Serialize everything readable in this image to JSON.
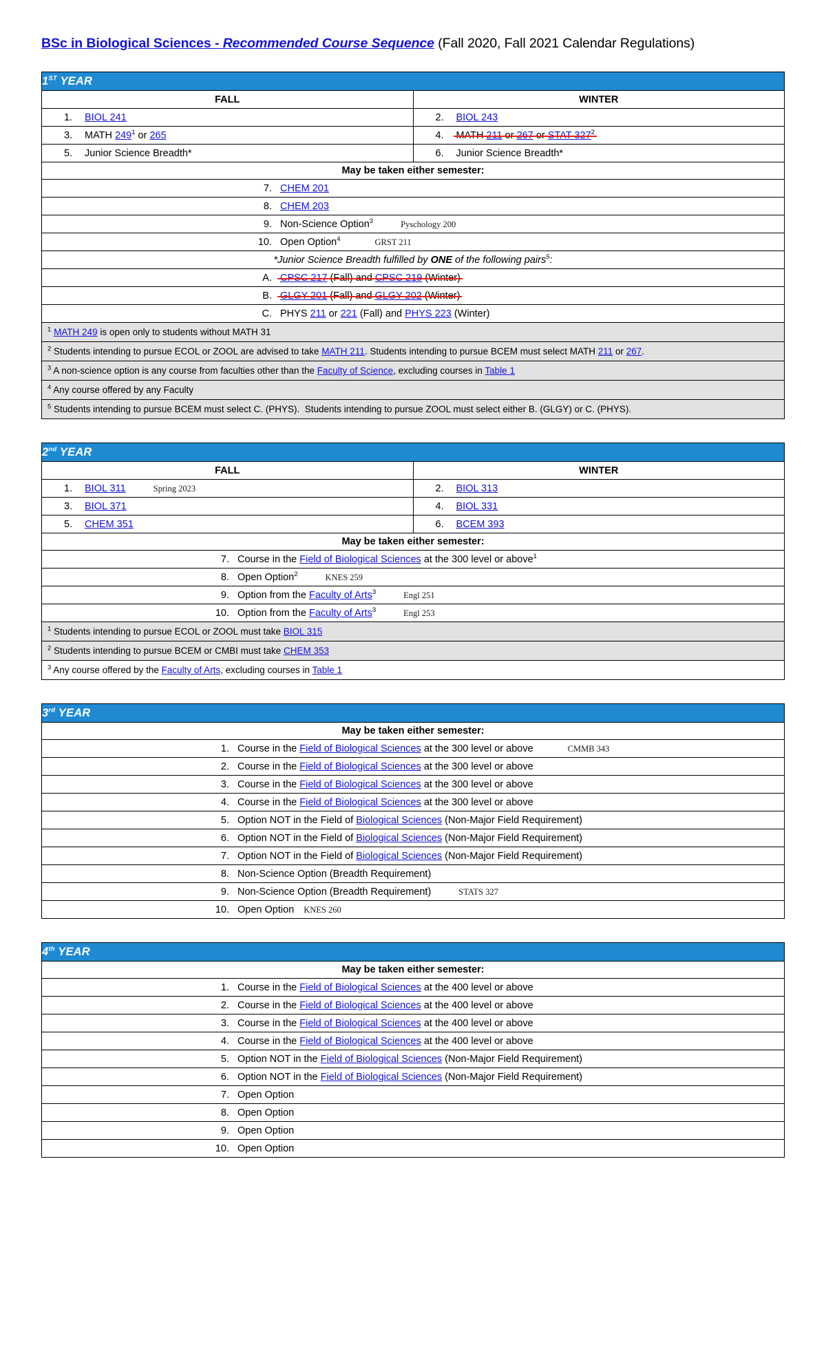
{
  "title": {
    "link_part": "BSc in Biological Sciences - ",
    "link_italic": "Recommended Course Sequence",
    "plain_part": " (Fall 2020, Fall 2021 Calendar Regulations)"
  },
  "year1": {
    "banner": "1ST YEAR",
    "banner_num": "1",
    "banner_sup": "ST",
    "banner_word": "YEAR",
    "col_fall": "FALL",
    "col_winter": "WINTER",
    "rows": [
      {
        "n1": "1.",
        "t1": "BIOL 241",
        "n2": "2.",
        "t2": "BIOL 243"
      },
      {
        "n1": "3.",
        "t1": "MATH 249¹ or 265",
        "n2": "4.",
        "t2": "MATH 211 or 267 or STAT 327²"
      },
      {
        "n1": "5.",
        "t1": "Junior Science Breadth*",
        "n2": "6.",
        "t2": "Junior Science Breadth*"
      }
    ],
    "either_semester": "May be taken either semester:",
    "items": [
      {
        "n": "7.",
        "t": "CHEM 201",
        "note": ""
      },
      {
        "n": "8.",
        "t": "CHEM 203",
        "note": ""
      },
      {
        "n": "9.",
        "t": "Non-Science Option³",
        "note": "Pyschology 200"
      },
      {
        "n": "10.",
        "t": "Open Option⁴",
        "note": "GRST 211"
      }
    ],
    "pairs_header": "*Junior Science Breadth fulfilled by ONE of the following pairs⁵:",
    "pairs_header_pre": "*Junior Science Breadth fulfilled by ",
    "pairs_header_bold": "ONE",
    "pairs_header_post": " of the following pairs",
    "pairs_header_sup": "5",
    "pairs_header_colon": ":",
    "pairs": [
      {
        "letter": "A.",
        "text": "CPSC 217 (Fall) and CPSC 219 (Winter)",
        "struck": true
      },
      {
        "letter": "B.",
        "text": "GLGY 201 (Fall) and GLGY 202 (Winter)",
        "struck": true
      },
      {
        "letter": "C.",
        "text": "PHYS 211 or 221 (Fall) and PHYS 223 (Winter)",
        "struck": false
      }
    ],
    "footnotes": [
      "¹ MATH 249 is open only to students without MATH 31",
      "² Students intending to pursue ECOL or ZOOL are advised to take MATH 211. Students intending to pursue BCEM must select MATH 211 or 267.",
      "³ A non-science option is any course from faculties other than the Faculty of Science, excluding courses in Table 1",
      "⁴ Any course offered by any Faculty",
      "⁵ Students intending to pursue BCEM must select C. (PHYS).  Students intending to pursue ZOOL must select either B. (GLGY) or C. (PHYS)."
    ]
  },
  "year2": {
    "banner_num": "2",
    "banner_sup": "nd",
    "banner_word": "YEAR",
    "col_fall": "FALL",
    "col_winter": "WINTER",
    "rows": [
      {
        "n1": "1.",
        "t1": "BIOL 311",
        "note1": "Spring 2023",
        "n2": "2.",
        "t2": "BIOL 313"
      },
      {
        "n1": "3.",
        "t1": "BIOL 371",
        "note1": "",
        "n2": "4.",
        "t2": "BIOL 331"
      },
      {
        "n1": "5.",
        "t1": "CHEM 351",
        "note1": "",
        "n2": "6.",
        "t2": "BCEM 393"
      }
    ],
    "either_semester": "May be taken either semester:",
    "items": [
      {
        "n": "7.",
        "t": "Course in the Field of Biological Sciences at the 300 level or above¹",
        "note": ""
      },
      {
        "n": "8.",
        "t": "Open Option²",
        "note": "KNES 259"
      },
      {
        "n": "9.",
        "t": "Option from the Faculty of Arts³",
        "note": "Engl 251"
      },
      {
        "n": "10.",
        "t": "Option from the Faculty of Arts³",
        "note": "Engl 253"
      }
    ],
    "footnotes": [
      "¹ Students intending to pursue ECOL or ZOOL must take BIOL 315",
      "² Students intending to pursue BCEM or CMBI must take CHEM 353",
      "³ Any course offered by the Faculty of Arts, excluding courses in Table 1"
    ]
  },
  "year3": {
    "banner_num": "3",
    "banner_sup": "rd",
    "banner_word": "YEAR",
    "either_semester": "May be taken either semester:",
    "items": [
      {
        "n": "1.",
        "t": "Course in the Field of Biological Sciences at the 300 level or above",
        "note": "CMMB 343"
      },
      {
        "n": "2.",
        "t": "Course in the Field of Biological Sciences at the 300 level or above",
        "note": ""
      },
      {
        "n": "3.",
        "t": "Course in the Field of Biological Sciences at the 300 level or above",
        "note": ""
      },
      {
        "n": "4.",
        "t": "Course in the Field of Biological Sciences at the 300 level or above",
        "note": ""
      },
      {
        "n": "5.",
        "t": "Option NOT in the Field of Biological Sciences (Non-Major Field Requirement)",
        "note": ""
      },
      {
        "n": "6.",
        "t": "Option NOT in the Field of Biological Sciences (Non-Major Field Requirement)",
        "note": ""
      },
      {
        "n": "7.",
        "t": "Option NOT in the Field of Biological Sciences (Non-Major Field Requirement)",
        "note": ""
      },
      {
        "n": "8.",
        "t": "Non-Science Option (Breadth Requirement)",
        "note": ""
      },
      {
        "n": "9.",
        "t": "Non-Science Option (Breadth Requirement)",
        "note": "STATS 327"
      },
      {
        "n": "10.",
        "t": "Open Option",
        "note": "KNES 260"
      }
    ]
  },
  "year4": {
    "banner_num": "4",
    "banner_sup": "th",
    "banner_word": "YEAR",
    "either_semester": "May be taken either semester:",
    "items": [
      {
        "n": "1.",
        "t": "Course in the Field of Biological Sciences at the 400 level or above"
      },
      {
        "n": "2.",
        "t": "Course in the Field of Biological Sciences at the 400 level or above"
      },
      {
        "n": "3.",
        "t": "Course in the Field of Biological Sciences at the 400 level or above"
      },
      {
        "n": "4.",
        "t": "Course in the Field of Biological Sciences at the 400 level or above"
      },
      {
        "n": "5.",
        "t": "Option NOT in the Field of Biological Sciences (Non-Major Field Requirement)"
      },
      {
        "n": "6.",
        "t": "Option NOT in the Field of Biological Sciences (Non-Major Field Requirement)"
      },
      {
        "n": "7.",
        "t": "Open Option"
      },
      {
        "n": "8.",
        "t": "Open Option"
      },
      {
        "n": "9.",
        "t": "Open Option"
      },
      {
        "n": "10.",
        "t": "Open Option"
      }
    ]
  },
  "colors": {
    "banner_blue": "#1f8ad2",
    "link_blue": "#1414d6",
    "strike_red": "#e8231a",
    "note_gray": "#e2e2e2"
  }
}
